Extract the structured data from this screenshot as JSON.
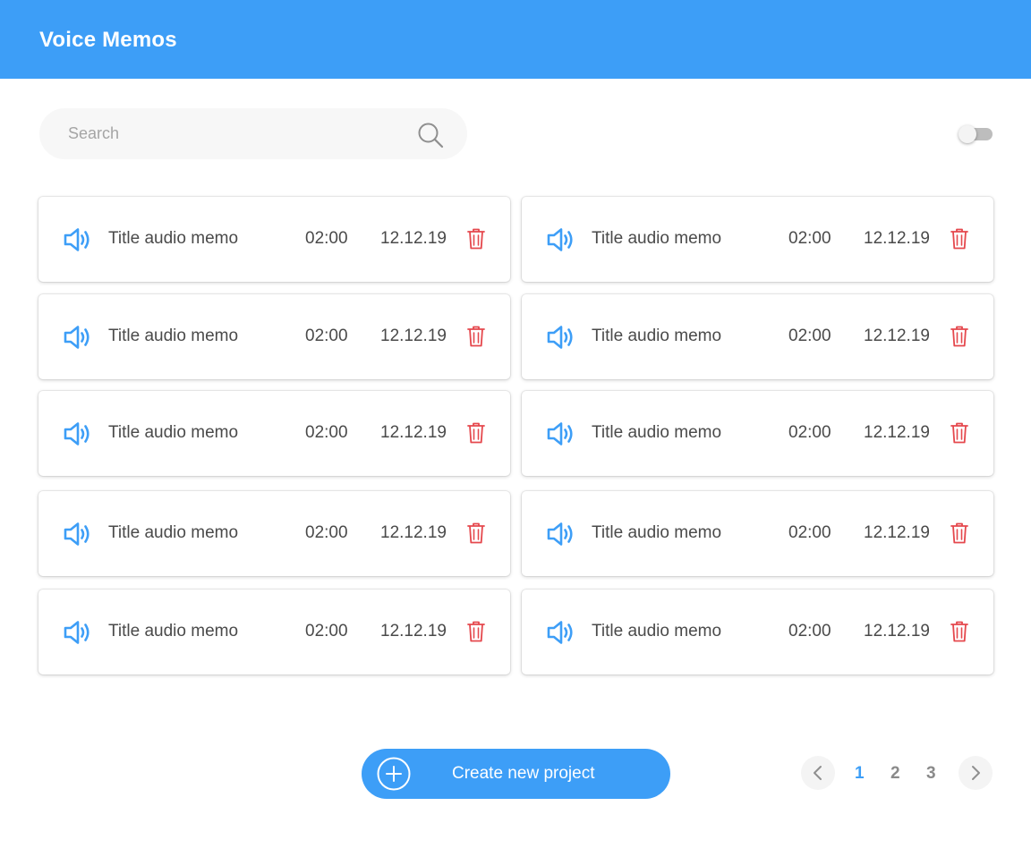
{
  "header": {
    "title": "Voice Memos"
  },
  "search": {
    "placeholder": "Search",
    "value": ""
  },
  "toggle": {
    "on": false
  },
  "memos": [
    {
      "title": "Title audio memo",
      "duration": "02:00",
      "date": "12.12.19"
    },
    {
      "title": "Title audio memo",
      "duration": "02:00",
      "date": "12.12.19"
    },
    {
      "title": "Title audio memo",
      "duration": "02:00",
      "date": "12.12.19"
    },
    {
      "title": "Title audio memo",
      "duration": "02:00",
      "date": "12.12.19"
    },
    {
      "title": "Title audio memo",
      "duration": "02:00",
      "date": "12.12.19"
    },
    {
      "title": "Title audio memo",
      "duration": "02:00",
      "date": "12.12.19"
    },
    {
      "title": "Title audio memo",
      "duration": "02:00",
      "date": "12.12.19"
    },
    {
      "title": "Title audio memo",
      "duration": "02:00",
      "date": "12.12.19"
    },
    {
      "title": "Title audio memo",
      "duration": "02:00",
      "date": "12.12.19"
    },
    {
      "title": "Title audio memo",
      "duration": "02:00",
      "date": "12.12.19"
    }
  ],
  "create_button": {
    "label": "Create new project",
    "icon": "plus-circle-icon"
  },
  "pagination": {
    "pages": [
      "1",
      "2",
      "3"
    ],
    "current": "1",
    "prev_icon": "chevron-left-icon",
    "next_icon": "chevron-right-icon"
  },
  "colors": {
    "accent": "#3d9ef7",
    "delete": "#e5484d",
    "text": "#4a4a4a",
    "page_inactive": "#8a8a8a"
  }
}
